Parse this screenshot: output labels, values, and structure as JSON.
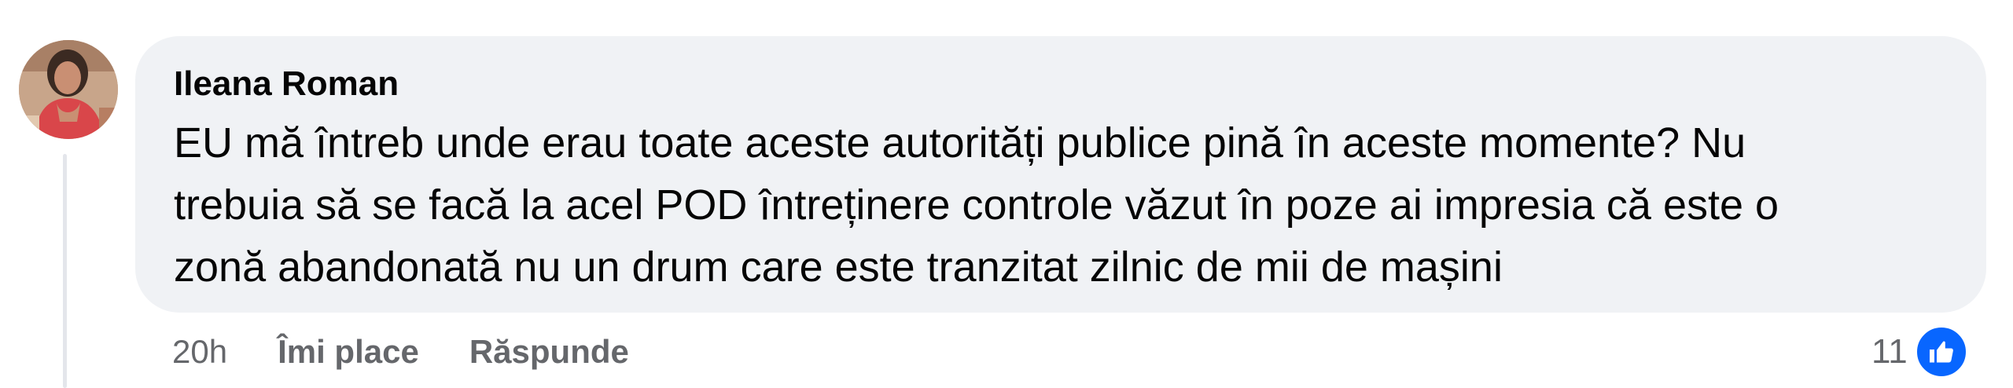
{
  "comment": {
    "author": "Ileana Roman",
    "text_lines": [
      "EU mă întreb unde erau toate aceste autorități publice pină în aceste momente? Nu",
      "trebuia să se facă la acel POD întreținere controle văzut în poze ai impresia că este o",
      "zonă abandonată nu un drum care este tranzitat zilnic de mii de mașini"
    ],
    "timestamp": "20h",
    "like_label": "Îmi place",
    "reply_label": "Răspunde",
    "reaction_count": "11",
    "reaction_icon": "thumbs-up-icon"
  },
  "colors": {
    "bubble": "#f0f2f5",
    "text": "#050505",
    "secondary_text": "#65676b",
    "like_blue": "#0866ff"
  }
}
